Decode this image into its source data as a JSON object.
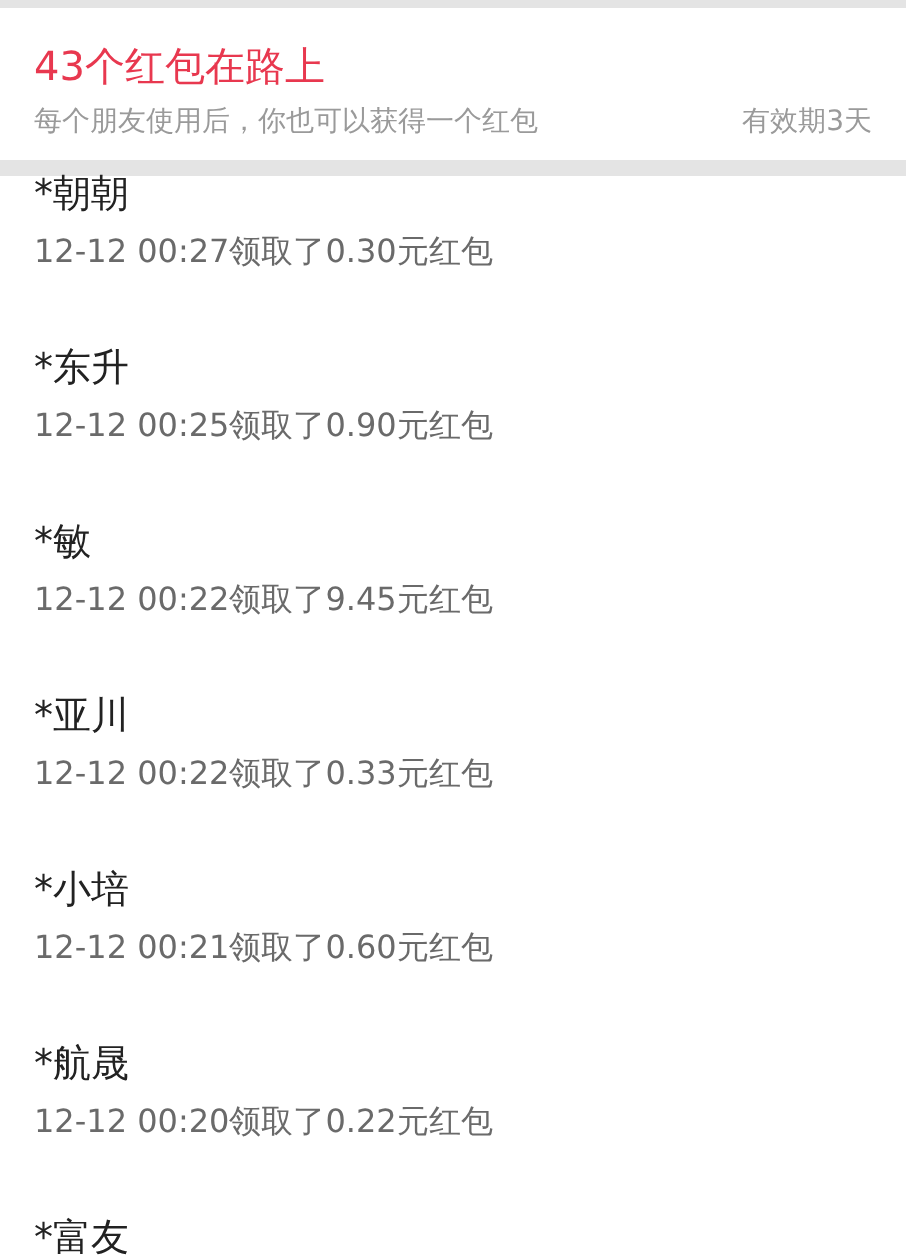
{
  "header": {
    "title": "43个红包在路上",
    "subtitle": "每个朋友使用后，你也可以获得一个红包",
    "validity": "有效期3天"
  },
  "records": [
    {
      "name": "*朝朝",
      "detail": "12-12 00:27领取了0.30元红包"
    },
    {
      "name": "*东升",
      "detail": "12-12 00:25领取了0.90元红包"
    },
    {
      "name": "*敏",
      "detail": "12-12 00:22领取了9.45元红包"
    },
    {
      "name": "*亚川",
      "detail": "12-12 00:22领取了0.33元红包"
    },
    {
      "name": "*小培",
      "detail": "12-12 00:21领取了0.60元红包"
    },
    {
      "name": "*航晟",
      "detail": "12-12 00:20领取了0.22元红包"
    },
    {
      "name": "*富友"
    }
  ]
}
